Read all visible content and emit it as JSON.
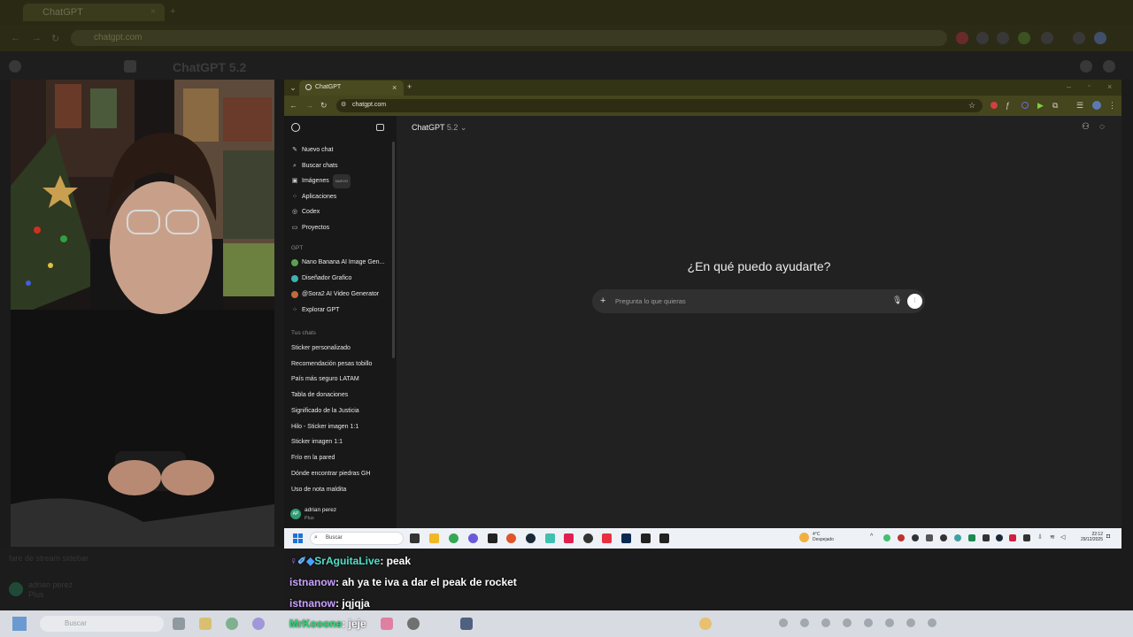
{
  "outer_browser": {
    "tab_title": "ChatGPT",
    "url": "chatgpt.com",
    "app_title": "ChatGPT 5.2"
  },
  "inner_browser": {
    "tab_title": "ChatGPT",
    "url": "chatgpt.com"
  },
  "sidebar": {
    "nav": [
      {
        "label": "Nuevo chat",
        "icon": "edit-icon"
      },
      {
        "label": "Buscar chats",
        "icon": "search-icon"
      },
      {
        "label": "Imágenes",
        "icon": "image-icon",
        "badge": "NUEVO"
      },
      {
        "label": "Aplicaciones",
        "icon": "apps-icon"
      },
      {
        "label": "Codex",
        "icon": "codex-icon"
      },
      {
        "label": "Proyectos",
        "icon": "folder-icon"
      }
    ],
    "gpt_header": "GPT",
    "gpts": [
      "Nano Banana AI Image Gen...",
      "Diseñador Grafico",
      "@Sora2 AI Video Generator",
      "Explorar GPT"
    ],
    "chats_header": "Tus chats",
    "chats": [
      "Sticker personalizado",
      "Recomendación pesas tobillo",
      "País más seguro LATAM",
      "Tabla de donaciones",
      "Significado de la Justicia",
      "Hilo - Sticker imagen 1:1",
      "Sticker imagen 1:1",
      "Frío en la pared",
      "Dónde encontrar piedras GH",
      "Uso de nota maldita"
    ],
    "user": {
      "name": "adrian perez",
      "plan": "Plus",
      "initials": "AP"
    }
  },
  "main": {
    "model": "ChatGPT",
    "model_version": "5.2",
    "headline": "¿En qué puedo ayudarte?",
    "prompt_placeholder": "Pregunta lo que quieras"
  },
  "taskbar": {
    "search_label": "Buscar",
    "weather_temp": "4°C",
    "weather_text": "Despejado",
    "time": "22:12",
    "date": "29/12/2025"
  },
  "stream_chat": [
    {
      "user": "SrAguitaLive",
      "message": "peak"
    },
    {
      "user": "istnanow",
      "message": "ah ya te iva a dar el peak de rocket"
    },
    {
      "user": "istnanow",
      "message": "jqjqja"
    },
    {
      "user": "MrKooone",
      "message": "jeje"
    }
  ],
  "outer_taskbar": {
    "search_label": "Buscar"
  },
  "outer_side": {
    "note": "fare de stream sidebar",
    "user_name": "adrian perez",
    "user_plan": "Plus"
  },
  "colors": {
    "accent_green": "#2fd873",
    "accent_purple": "#c9a1ff",
    "bg": "#212121"
  }
}
